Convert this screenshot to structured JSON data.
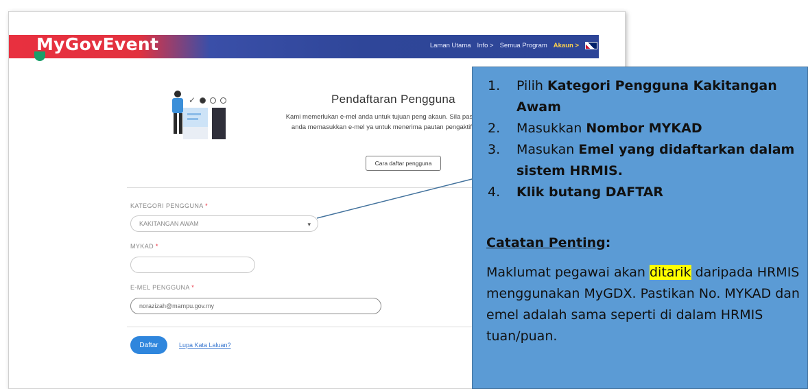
{
  "app": {
    "logo_text": "MyGovEvent",
    "nav": {
      "home": "Laman Utama",
      "info": "Info >",
      "programs": "Semua Program",
      "account": "Akaun >"
    }
  },
  "register": {
    "title": "Pendaftaran Pengguna",
    "description": "Kami memerlukan e-mel anda untuk tujuan peng akaun. Sila pastikan anda memasukkan e-mel ya untuk menerima pautan pengaktifan.",
    "howto_button": "Cara daftar pengguna",
    "category": {
      "label": "KATEGORI PENGGUNA",
      "required": "*",
      "value": "KAKITANGAN AWAM"
    },
    "mykad": {
      "label": "MYKAD",
      "required": "*",
      "value": ""
    },
    "email": {
      "label": "E-MEL PENGGUNA",
      "required": "*",
      "value": "norazizah@mampu.gov.my"
    },
    "submit_label": "Daftar",
    "forgot_link": "Lupa Kata Laluan?"
  },
  "callout": {
    "steps": [
      {
        "num": "1.",
        "text": "Pilih ",
        "bold": "Kategori Pengguna Kakitangan Awam"
      },
      {
        "num": "2.",
        "text": "Masukkan ",
        "bold": "Nombor MYKAD"
      },
      {
        "num": "3.",
        "text": "Masukan ",
        "bold": "Emel yang didaftarkan dalam sistem HRMIS."
      },
      {
        "num": "4.",
        "text": "",
        "bold": "Klik butang DAFTAR"
      }
    ],
    "note_title": "Catatan Penting",
    "note_colon": ":",
    "note_pre": "Maklumat pegawai akan ",
    "note_highlight": "ditarik",
    "note_post": " daripada HRMIS menggunakan MyGDX. Pastikan No. MYKAD dan emel adalah sama seperti di dalam HRMIS tuan/puan."
  },
  "colors": {
    "callout_bg": "#5b9bd5",
    "primary_button": "#2f86dd",
    "brand_red": "#e8303f",
    "nav_blue": "#2d4597",
    "highlight": "#ffff00"
  },
  "icons": [
    "person-illustration",
    "chevron-down-icon",
    "uk-flag-icon"
  ]
}
